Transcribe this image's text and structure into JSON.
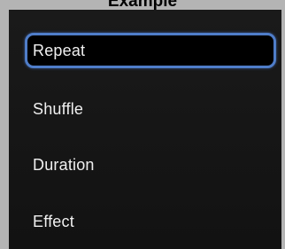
{
  "caption": "Example",
  "menu": {
    "items": [
      {
        "label": "Repeat",
        "selected": true
      },
      {
        "label": "Shuffle",
        "selected": false
      },
      {
        "label": "Duration",
        "selected": false
      },
      {
        "label": "Effect",
        "selected": false
      }
    ]
  },
  "colors": {
    "background": "#b4b4b4",
    "menu_background": "#141414",
    "selection_border": "#4f7dc9",
    "text": "#f0f0f0"
  }
}
